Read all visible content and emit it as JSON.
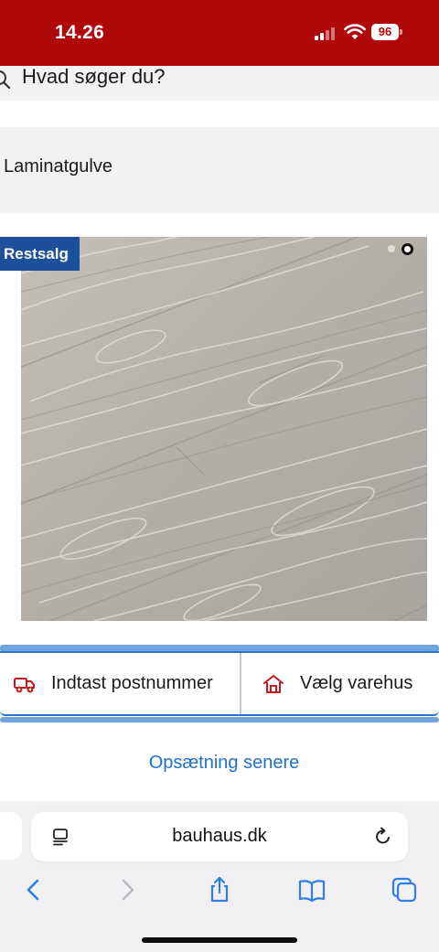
{
  "status_bar": {
    "time": "14.26",
    "battery": "96",
    "background": "#b0090b"
  },
  "search": {
    "text": "Hvad søger du?"
  },
  "category": {
    "label": "Laminatgulve"
  },
  "product": {
    "badge": "Restsalg",
    "badge_color": "#1d4f9a",
    "image_description_icon": "laminate-floor-photo",
    "carousel_total": 2,
    "carousel_active": 2
  },
  "options": {
    "zip_label": "Indtast postnummer",
    "store_label": "Vælg varehus",
    "zip_icon": "truck-icon",
    "store_icon": "store-icon",
    "accent": "#2e6fd0"
  },
  "later_link": "Opsætning senere",
  "browser": {
    "url": "bauhaus.dk",
    "buttons": [
      "back",
      "forward",
      "share",
      "bookmarks",
      "tabs"
    ],
    "accent": "#2f7ee6"
  }
}
